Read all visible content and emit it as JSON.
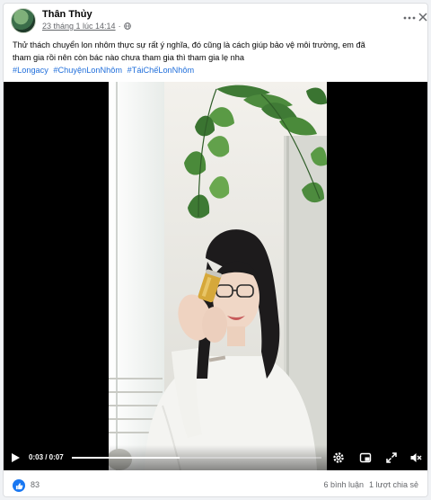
{
  "post": {
    "author": "Thân Thủy",
    "timestamp": "23 tháng 1 lúc 14:14",
    "separator": "·",
    "privacy_icon": "globe-icon",
    "caption_line1": "Thử thách chuyển lon nhôm thực sự rất ý nghĩa, đó cũng là cách giúp bảo vệ môi trường, em đã",
    "caption_line2": "tham gia rồi nên còn bác nào chưa tham gia thì tham gia lẹ nha",
    "hashtags": [
      "#Longacy",
      "#ChuyệnLonNhôm",
      "#TáiChếLonNhôm"
    ]
  },
  "video": {
    "timecode": "0:03 / 0:07",
    "progress": 0.43,
    "icons": [
      "play-icon",
      "settings-icon",
      "miniplayer-icon",
      "fullscreen-icon",
      "volume-muted-icon"
    ]
  },
  "footer": {
    "reaction_icon": "like-icon",
    "reaction_count": "83",
    "comments": "6 bình luận",
    "shares": "1 lượt chia sẻ"
  },
  "colors": {
    "link": "#216fdb",
    "brand": "#1877f2",
    "muted_text": "#65676b"
  }
}
